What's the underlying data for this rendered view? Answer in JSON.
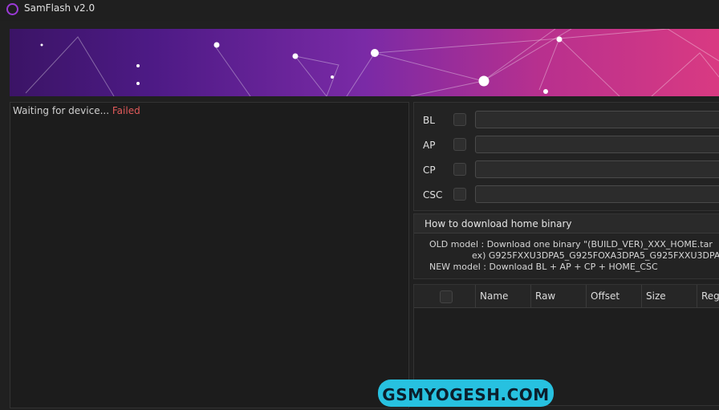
{
  "window": {
    "title": "SamFlash v2.0",
    "icon": "app-logo-icon"
  },
  "log": {
    "prefix": "Waiting for device...",
    "status": "Failed"
  },
  "files": [
    {
      "label": "BL",
      "value": "",
      "checked": false
    },
    {
      "label": "AP",
      "value": "",
      "checked": false
    },
    {
      "label": "CP",
      "value": "",
      "checked": false
    },
    {
      "label": "CSC",
      "value": "",
      "checked": false
    }
  ],
  "info": {
    "title": "How to download home binary",
    "lines": [
      "OLD model  : Download one binary \"(BUILD_VER)_XXX_HOME.tar",
      "ex) G925FXXU3DPA5_G925FOXA3DPA5_G925FXXU3DPA",
      "NEW model : Download BL + AP + CP + HOME_CSC"
    ]
  },
  "table": {
    "columns": [
      "Name",
      "Raw",
      "Offset",
      "Size",
      "Regi"
    ],
    "rows": []
  },
  "watermark": "GSMYOGESH.COM",
  "colors": {
    "accent": "#9b3ad6",
    "failed": "#e05a5a",
    "watermark_bg": "#27c1e0"
  }
}
